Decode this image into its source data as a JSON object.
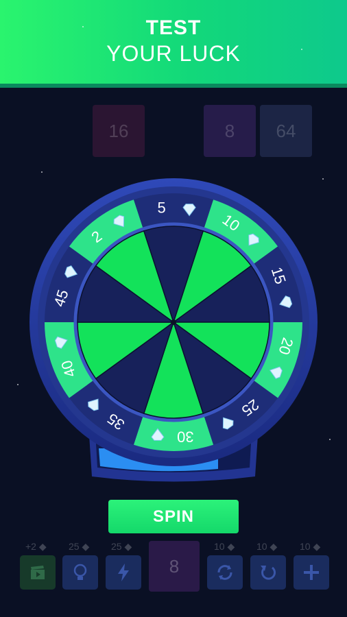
{
  "banner": {
    "line1": "TEST",
    "line2": "YOUR LUCK"
  },
  "board": {
    "tiles": [
      {
        "value": "16",
        "color": "#2b1532"
      },
      {
        "value": "8",
        "color": "#261c4a"
      },
      {
        "value": "64",
        "color": "#1c2545"
      }
    ]
  },
  "wheel": {
    "prizes": [
      "5",
      "10",
      "15",
      "20",
      "25",
      "30",
      "35",
      "40",
      "45",
      "2"
    ],
    "prize_icon": "diamond-icon",
    "colors": {
      "green": "#2ee38a",
      "navy": "#1e2d78",
      "rim": "#2a3f9e",
      "center_green": "#13e25a",
      "center_navy": "#17215a"
    },
    "progress_fraction": 0.87
  },
  "spin_button": {
    "label": "SPIN"
  },
  "toolbar": {
    "center_tile": "8",
    "items": [
      {
        "cost": "+2",
        "icon": "video-clapper-icon"
      },
      {
        "cost": "25",
        "icon": "lightbulb-icon"
      },
      {
        "cost": "25",
        "icon": "lightning-icon"
      },
      {
        "cost": "10",
        "icon": "refresh-icon"
      },
      {
        "cost": "10",
        "icon": "undo-icon"
      },
      {
        "cost": "10",
        "icon": "plus-icon"
      }
    ]
  }
}
